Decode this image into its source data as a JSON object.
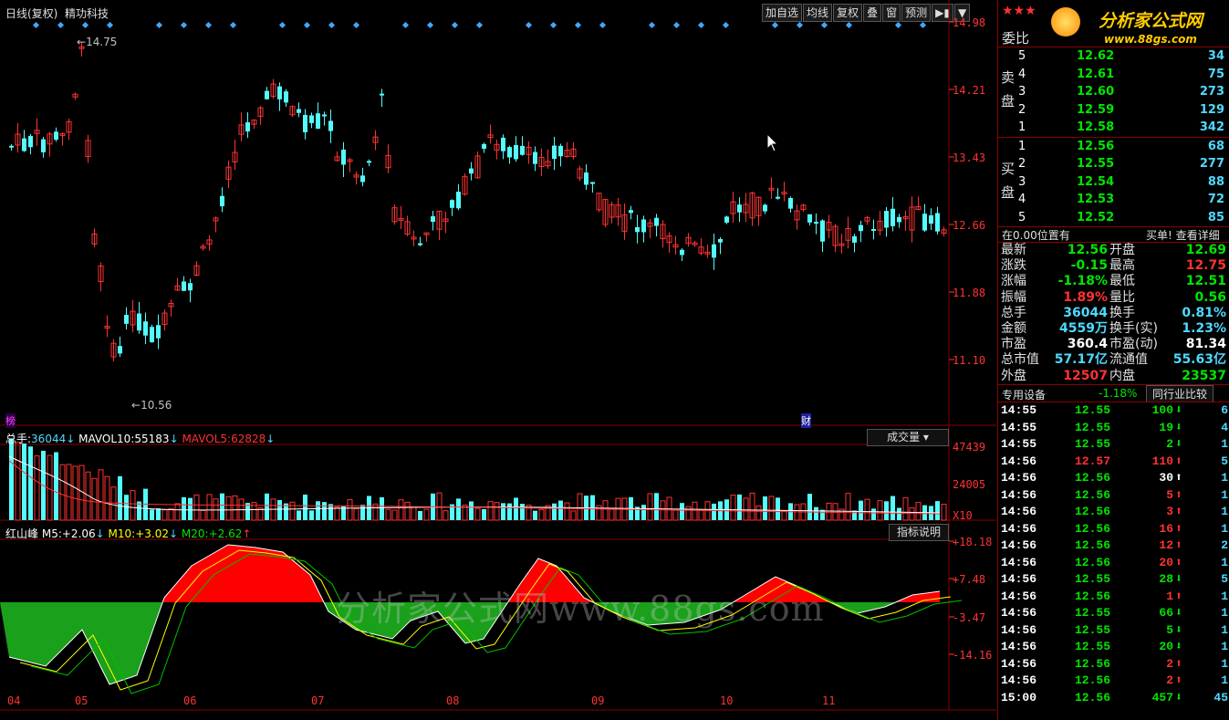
{
  "header": {
    "period": "日线(复权)",
    "stock_name": "精功科技",
    "toolbar": [
      "加自选",
      "均线",
      "复权",
      "叠",
      "窗",
      "预测"
    ]
  },
  "logo": {
    "text": "分析家公式网",
    "url": "www.88gs.com",
    "stars": "★★★"
  },
  "price_axis": [
    "14.98",
    "14.21",
    "13.43",
    "12.66",
    "11.88",
    "11.10"
  ],
  "annotations": {
    "high": "14.75",
    "low": "10.56",
    "bang": "榜",
    "cai": "财"
  },
  "volume": {
    "label_total": "总手:",
    "total": "36044",
    "mavol10_label": "MAVOL10:",
    "mavol10": "55183",
    "mavol5_label": "MAVOL5:",
    "mavol5": "62828",
    "selector": "成交量",
    "axis": [
      "47439",
      "24005",
      "X10"
    ]
  },
  "indicator": {
    "name": "红山峰",
    "m5_label": "M5:",
    "m5": "+2.06",
    "m10_label": "M10:",
    "m10": "+3.02",
    "m20_label": "M20:",
    "m20": "+2.62",
    "button": "指标说明",
    "axis": [
      "+18.18",
      "+7.48",
      "-3.47",
      "-14.16"
    ],
    "watermark": "分析家公式网www.88gs.com"
  },
  "x_axis": [
    "04",
    "05",
    "06",
    "07",
    "08",
    "09",
    "10",
    "11"
  ],
  "order_book": {
    "title": "委比",
    "sell_label": "卖盘",
    "buy_label": "买盘",
    "sell": [
      {
        "lvl": "5",
        "price": "12.62",
        "vol": "34"
      },
      {
        "lvl": "4",
        "price": "12.61",
        "vol": "75"
      },
      {
        "lvl": "3",
        "price": "12.60",
        "vol": "273"
      },
      {
        "lvl": "2",
        "price": "12.59",
        "vol": "129"
      },
      {
        "lvl": "1",
        "price": "12.58",
        "vol": "342"
      }
    ],
    "buy": [
      {
        "lvl": "1",
        "price": "12.56",
        "vol": "68"
      },
      {
        "lvl": "2",
        "price": "12.55",
        "vol": "277"
      },
      {
        "lvl": "3",
        "price": "12.54",
        "vol": "88"
      },
      {
        "lvl": "4",
        "price": "12.53",
        "vol": "72"
      },
      {
        "lvl": "5",
        "price": "12.52",
        "vol": "85"
      }
    ],
    "position_text": "在0.00位置有",
    "buy_detail": "买单! 查看详细"
  },
  "quote": [
    {
      "l": "最新",
      "lv": "12.56",
      "r": "开盘",
      "rv": "12.69"
    },
    {
      "l": "涨跌",
      "lv": "-0.15",
      "r": "最高",
      "rv": "12.75"
    },
    {
      "l": "涨幅",
      "lv": "-1.18%",
      "r": "最低",
      "rv": "12.51"
    },
    {
      "l": "振幅",
      "lv": "1.89%",
      "r": "量比",
      "rv": "0.56"
    },
    {
      "l": "总手",
      "lv": "36044",
      "r": "换手",
      "rv": "0.81%"
    },
    {
      "l": "金额",
      "lv": "4559万",
      "r": "换手(实)",
      "rv": "1.23%"
    },
    {
      "l": "市盈",
      "lv": "360.4",
      "r": "市盈(动)",
      "rv": "81.34"
    },
    {
      "l": "总市值",
      "lv": "57.17亿",
      "r": "流通值",
      "rv": "55.63亿"
    },
    {
      "l": "外盘",
      "lv": "12507",
      "r": "内盘",
      "rv": "23537"
    }
  ],
  "industry": {
    "label": "专用设备",
    "change": "-1.18%",
    "button": "同行业比较"
  },
  "ticks": [
    {
      "t": "14:55",
      "p": "12.55",
      "v": "100",
      "d": "dn",
      "n": "6"
    },
    {
      "t": "14:55",
      "p": "12.55",
      "v": "19",
      "d": "dn",
      "n": "4"
    },
    {
      "t": "14:55",
      "p": "12.55",
      "v": "2",
      "d": "dn",
      "n": "1"
    },
    {
      "t": "14:56",
      "p": "12.57",
      "v": "110",
      "d": "up",
      "n": "5"
    },
    {
      "t": "14:56",
      "p": "12.56",
      "v": "30",
      "d": "upw",
      "n": "1"
    },
    {
      "t": "14:56",
      "p": "12.56",
      "v": "5",
      "d": "up",
      "n": "1"
    },
    {
      "t": "14:56",
      "p": "12.56",
      "v": "3",
      "d": "up",
      "n": "1"
    },
    {
      "t": "14:56",
      "p": "12.56",
      "v": "16",
      "d": "up",
      "n": "1"
    },
    {
      "t": "14:56",
      "p": "12.56",
      "v": "12",
      "d": "up",
      "n": "2"
    },
    {
      "t": "14:56",
      "p": "12.56",
      "v": "20",
      "d": "up",
      "n": "1"
    },
    {
      "t": "14:56",
      "p": "12.55",
      "v": "28",
      "d": "dn",
      "n": "5"
    },
    {
      "t": "14:56",
      "p": "12.56",
      "v": "1",
      "d": "up",
      "n": "1"
    },
    {
      "t": "14:56",
      "p": "12.55",
      "v": "66",
      "d": "dn",
      "n": "1"
    },
    {
      "t": "14:56",
      "p": "12.55",
      "v": "5",
      "d": "dn",
      "n": "1"
    },
    {
      "t": "14:56",
      "p": "12.55",
      "v": "20",
      "d": "dn",
      "n": "1"
    },
    {
      "t": "14:56",
      "p": "12.56",
      "v": "2",
      "d": "up",
      "n": "1"
    },
    {
      "t": "14:56",
      "p": "12.56",
      "v": "2",
      "d": "up",
      "n": "1"
    },
    {
      "t": "15:00",
      "p": "12.56",
      "v": "457",
      "d": "dn",
      "n": "45"
    }
  ],
  "colors": {
    "up": "#ff3232",
    "down": "#54fcfc",
    "grid": "#8a0000",
    "green_fill": "#1aa01a",
    "red_fill": "#ff0000"
  }
}
